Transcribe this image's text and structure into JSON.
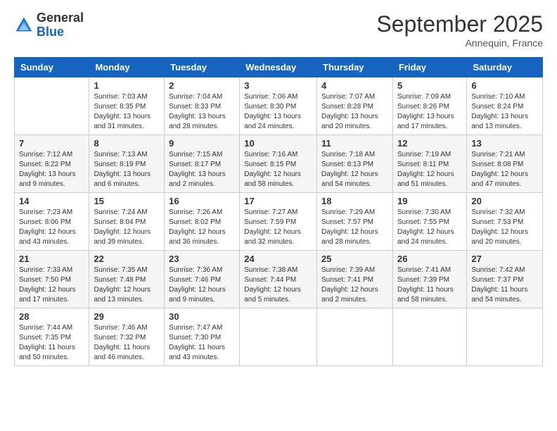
{
  "logo": {
    "line1": "General",
    "line2": "Blue"
  },
  "title": "September 2025",
  "subtitle": "Annequin, France",
  "days_header": [
    "Sunday",
    "Monday",
    "Tuesday",
    "Wednesday",
    "Thursday",
    "Friday",
    "Saturday"
  ],
  "weeks": [
    [
      {
        "num": "",
        "sunrise": "",
        "sunset": "",
        "daylight": ""
      },
      {
        "num": "1",
        "sunrise": "Sunrise: 7:03 AM",
        "sunset": "Sunset: 8:35 PM",
        "daylight": "Daylight: 13 hours and 31 minutes."
      },
      {
        "num": "2",
        "sunrise": "Sunrise: 7:04 AM",
        "sunset": "Sunset: 8:33 PM",
        "daylight": "Daylight: 13 hours and 28 minutes."
      },
      {
        "num": "3",
        "sunrise": "Sunrise: 7:06 AM",
        "sunset": "Sunset: 8:30 PM",
        "daylight": "Daylight: 13 hours and 24 minutes."
      },
      {
        "num": "4",
        "sunrise": "Sunrise: 7:07 AM",
        "sunset": "Sunset: 8:28 PM",
        "daylight": "Daylight: 13 hours and 20 minutes."
      },
      {
        "num": "5",
        "sunrise": "Sunrise: 7:09 AM",
        "sunset": "Sunset: 8:26 PM",
        "daylight": "Daylight: 13 hours and 17 minutes."
      },
      {
        "num": "6",
        "sunrise": "Sunrise: 7:10 AM",
        "sunset": "Sunset: 8:24 PM",
        "daylight": "Daylight: 13 hours and 13 minutes."
      }
    ],
    [
      {
        "num": "7",
        "sunrise": "Sunrise: 7:12 AM",
        "sunset": "Sunset: 8:22 PM",
        "daylight": "Daylight: 13 hours and 9 minutes."
      },
      {
        "num": "8",
        "sunrise": "Sunrise: 7:13 AM",
        "sunset": "Sunset: 8:19 PM",
        "daylight": "Daylight: 13 hours and 6 minutes."
      },
      {
        "num": "9",
        "sunrise": "Sunrise: 7:15 AM",
        "sunset": "Sunset: 8:17 PM",
        "daylight": "Daylight: 13 hours and 2 minutes."
      },
      {
        "num": "10",
        "sunrise": "Sunrise: 7:16 AM",
        "sunset": "Sunset: 8:15 PM",
        "daylight": "Daylight: 12 hours and 58 minutes."
      },
      {
        "num": "11",
        "sunrise": "Sunrise: 7:18 AM",
        "sunset": "Sunset: 8:13 PM",
        "daylight": "Daylight: 12 hours and 54 minutes."
      },
      {
        "num": "12",
        "sunrise": "Sunrise: 7:19 AM",
        "sunset": "Sunset: 8:11 PM",
        "daylight": "Daylight: 12 hours and 51 minutes."
      },
      {
        "num": "13",
        "sunrise": "Sunrise: 7:21 AM",
        "sunset": "Sunset: 8:08 PM",
        "daylight": "Daylight: 12 hours and 47 minutes."
      }
    ],
    [
      {
        "num": "14",
        "sunrise": "Sunrise: 7:23 AM",
        "sunset": "Sunset: 8:06 PM",
        "daylight": "Daylight: 12 hours and 43 minutes."
      },
      {
        "num": "15",
        "sunrise": "Sunrise: 7:24 AM",
        "sunset": "Sunset: 8:04 PM",
        "daylight": "Daylight: 12 hours and 39 minutes."
      },
      {
        "num": "16",
        "sunrise": "Sunrise: 7:26 AM",
        "sunset": "Sunset: 8:02 PM",
        "daylight": "Daylight: 12 hours and 36 minutes."
      },
      {
        "num": "17",
        "sunrise": "Sunrise: 7:27 AM",
        "sunset": "Sunset: 7:59 PM",
        "daylight": "Daylight: 12 hours and 32 minutes."
      },
      {
        "num": "18",
        "sunrise": "Sunrise: 7:29 AM",
        "sunset": "Sunset: 7:57 PM",
        "daylight": "Daylight: 12 hours and 28 minutes."
      },
      {
        "num": "19",
        "sunrise": "Sunrise: 7:30 AM",
        "sunset": "Sunset: 7:55 PM",
        "daylight": "Daylight: 12 hours and 24 minutes."
      },
      {
        "num": "20",
        "sunrise": "Sunrise: 7:32 AM",
        "sunset": "Sunset: 7:53 PM",
        "daylight": "Daylight: 12 hours and 20 minutes."
      }
    ],
    [
      {
        "num": "21",
        "sunrise": "Sunrise: 7:33 AM",
        "sunset": "Sunset: 7:50 PM",
        "daylight": "Daylight: 12 hours and 17 minutes."
      },
      {
        "num": "22",
        "sunrise": "Sunrise: 7:35 AM",
        "sunset": "Sunset: 7:48 PM",
        "daylight": "Daylight: 12 hours and 13 minutes."
      },
      {
        "num": "23",
        "sunrise": "Sunrise: 7:36 AM",
        "sunset": "Sunset: 7:46 PM",
        "daylight": "Daylight: 12 hours and 9 minutes."
      },
      {
        "num": "24",
        "sunrise": "Sunrise: 7:38 AM",
        "sunset": "Sunset: 7:44 PM",
        "daylight": "Daylight: 12 hours and 5 minutes."
      },
      {
        "num": "25",
        "sunrise": "Sunrise: 7:39 AM",
        "sunset": "Sunset: 7:41 PM",
        "daylight": "Daylight: 12 hours and 2 minutes."
      },
      {
        "num": "26",
        "sunrise": "Sunrise: 7:41 AM",
        "sunset": "Sunset: 7:39 PM",
        "daylight": "Daylight: 11 hours and 58 minutes."
      },
      {
        "num": "27",
        "sunrise": "Sunrise: 7:42 AM",
        "sunset": "Sunset: 7:37 PM",
        "daylight": "Daylight: 11 hours and 54 minutes."
      }
    ],
    [
      {
        "num": "28",
        "sunrise": "Sunrise: 7:44 AM",
        "sunset": "Sunset: 7:35 PM",
        "daylight": "Daylight: 11 hours and 50 minutes."
      },
      {
        "num": "29",
        "sunrise": "Sunrise: 7:46 AM",
        "sunset": "Sunset: 7:32 PM",
        "daylight": "Daylight: 11 hours and 46 minutes."
      },
      {
        "num": "30",
        "sunrise": "Sunrise: 7:47 AM",
        "sunset": "Sunset: 7:30 PM",
        "daylight": "Daylight: 11 hours and 43 minutes."
      },
      {
        "num": "",
        "sunrise": "",
        "sunset": "",
        "daylight": ""
      },
      {
        "num": "",
        "sunrise": "",
        "sunset": "",
        "daylight": ""
      },
      {
        "num": "",
        "sunrise": "",
        "sunset": "",
        "daylight": ""
      },
      {
        "num": "",
        "sunrise": "",
        "sunset": "",
        "daylight": ""
      }
    ]
  ]
}
